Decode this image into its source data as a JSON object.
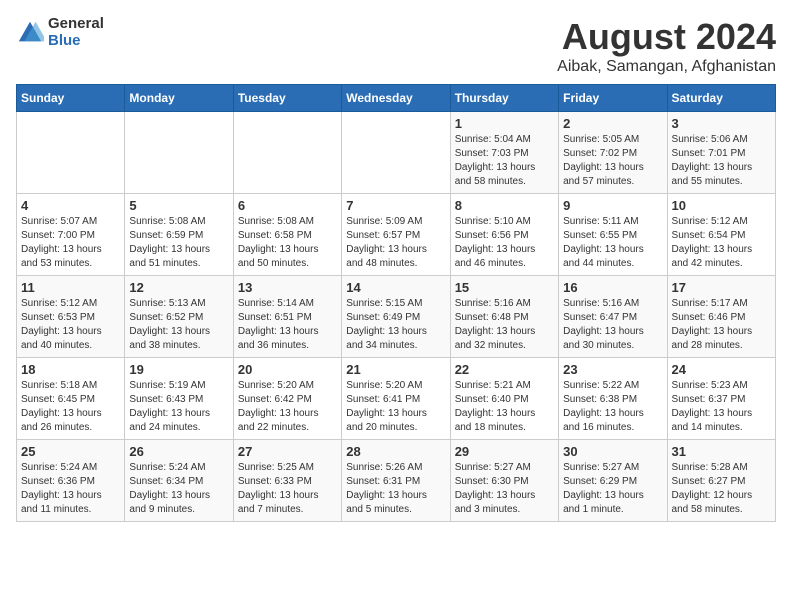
{
  "header": {
    "logo_general": "General",
    "logo_blue": "Blue",
    "title": "August 2024",
    "subtitle": "Aibak, Samangan, Afghanistan"
  },
  "weekdays": [
    "Sunday",
    "Monday",
    "Tuesday",
    "Wednesday",
    "Thursday",
    "Friday",
    "Saturday"
  ],
  "weeks": [
    [
      {
        "day": "",
        "info": ""
      },
      {
        "day": "",
        "info": ""
      },
      {
        "day": "",
        "info": ""
      },
      {
        "day": "",
        "info": ""
      },
      {
        "day": "1",
        "info": "Sunrise: 5:04 AM\nSunset: 7:03 PM\nDaylight: 13 hours\nand 58 minutes."
      },
      {
        "day": "2",
        "info": "Sunrise: 5:05 AM\nSunset: 7:02 PM\nDaylight: 13 hours\nand 57 minutes."
      },
      {
        "day": "3",
        "info": "Sunrise: 5:06 AM\nSunset: 7:01 PM\nDaylight: 13 hours\nand 55 minutes."
      }
    ],
    [
      {
        "day": "4",
        "info": "Sunrise: 5:07 AM\nSunset: 7:00 PM\nDaylight: 13 hours\nand 53 minutes."
      },
      {
        "day": "5",
        "info": "Sunrise: 5:08 AM\nSunset: 6:59 PM\nDaylight: 13 hours\nand 51 minutes."
      },
      {
        "day": "6",
        "info": "Sunrise: 5:08 AM\nSunset: 6:58 PM\nDaylight: 13 hours\nand 50 minutes."
      },
      {
        "day": "7",
        "info": "Sunrise: 5:09 AM\nSunset: 6:57 PM\nDaylight: 13 hours\nand 48 minutes."
      },
      {
        "day": "8",
        "info": "Sunrise: 5:10 AM\nSunset: 6:56 PM\nDaylight: 13 hours\nand 46 minutes."
      },
      {
        "day": "9",
        "info": "Sunrise: 5:11 AM\nSunset: 6:55 PM\nDaylight: 13 hours\nand 44 minutes."
      },
      {
        "day": "10",
        "info": "Sunrise: 5:12 AM\nSunset: 6:54 PM\nDaylight: 13 hours\nand 42 minutes."
      }
    ],
    [
      {
        "day": "11",
        "info": "Sunrise: 5:12 AM\nSunset: 6:53 PM\nDaylight: 13 hours\nand 40 minutes."
      },
      {
        "day": "12",
        "info": "Sunrise: 5:13 AM\nSunset: 6:52 PM\nDaylight: 13 hours\nand 38 minutes."
      },
      {
        "day": "13",
        "info": "Sunrise: 5:14 AM\nSunset: 6:51 PM\nDaylight: 13 hours\nand 36 minutes."
      },
      {
        "day": "14",
        "info": "Sunrise: 5:15 AM\nSunset: 6:49 PM\nDaylight: 13 hours\nand 34 minutes."
      },
      {
        "day": "15",
        "info": "Sunrise: 5:16 AM\nSunset: 6:48 PM\nDaylight: 13 hours\nand 32 minutes."
      },
      {
        "day": "16",
        "info": "Sunrise: 5:16 AM\nSunset: 6:47 PM\nDaylight: 13 hours\nand 30 minutes."
      },
      {
        "day": "17",
        "info": "Sunrise: 5:17 AM\nSunset: 6:46 PM\nDaylight: 13 hours\nand 28 minutes."
      }
    ],
    [
      {
        "day": "18",
        "info": "Sunrise: 5:18 AM\nSunset: 6:45 PM\nDaylight: 13 hours\nand 26 minutes."
      },
      {
        "day": "19",
        "info": "Sunrise: 5:19 AM\nSunset: 6:43 PM\nDaylight: 13 hours\nand 24 minutes."
      },
      {
        "day": "20",
        "info": "Sunrise: 5:20 AM\nSunset: 6:42 PM\nDaylight: 13 hours\nand 22 minutes."
      },
      {
        "day": "21",
        "info": "Sunrise: 5:20 AM\nSunset: 6:41 PM\nDaylight: 13 hours\nand 20 minutes."
      },
      {
        "day": "22",
        "info": "Sunrise: 5:21 AM\nSunset: 6:40 PM\nDaylight: 13 hours\nand 18 minutes."
      },
      {
        "day": "23",
        "info": "Sunrise: 5:22 AM\nSunset: 6:38 PM\nDaylight: 13 hours\nand 16 minutes."
      },
      {
        "day": "24",
        "info": "Sunrise: 5:23 AM\nSunset: 6:37 PM\nDaylight: 13 hours\nand 14 minutes."
      }
    ],
    [
      {
        "day": "25",
        "info": "Sunrise: 5:24 AM\nSunset: 6:36 PM\nDaylight: 13 hours\nand 11 minutes."
      },
      {
        "day": "26",
        "info": "Sunrise: 5:24 AM\nSunset: 6:34 PM\nDaylight: 13 hours\nand 9 minutes."
      },
      {
        "day": "27",
        "info": "Sunrise: 5:25 AM\nSunset: 6:33 PM\nDaylight: 13 hours\nand 7 minutes."
      },
      {
        "day": "28",
        "info": "Sunrise: 5:26 AM\nSunset: 6:31 PM\nDaylight: 13 hours\nand 5 minutes."
      },
      {
        "day": "29",
        "info": "Sunrise: 5:27 AM\nSunset: 6:30 PM\nDaylight: 13 hours\nand 3 minutes."
      },
      {
        "day": "30",
        "info": "Sunrise: 5:27 AM\nSunset: 6:29 PM\nDaylight: 13 hours\nand 1 minute."
      },
      {
        "day": "31",
        "info": "Sunrise: 5:28 AM\nSunset: 6:27 PM\nDaylight: 12 hours\nand 58 minutes."
      }
    ]
  ]
}
